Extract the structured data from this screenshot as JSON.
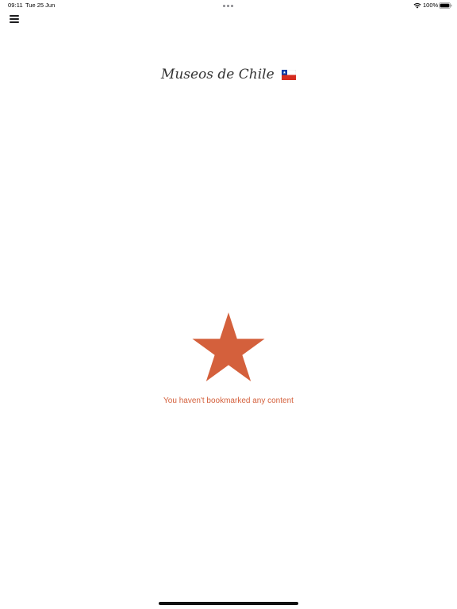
{
  "status_bar": {
    "time": "09:11",
    "date": "Tue 25 Jun",
    "battery": "100%"
  },
  "header": {
    "title": "Museos de Chile",
    "menu_icon": "hamburger-menu-icon",
    "flag_icon": "chile-flag-icon"
  },
  "empty_state": {
    "icon": "star-icon",
    "message": "You haven't bookmarked any content",
    "accent_color": "#d4603c"
  }
}
